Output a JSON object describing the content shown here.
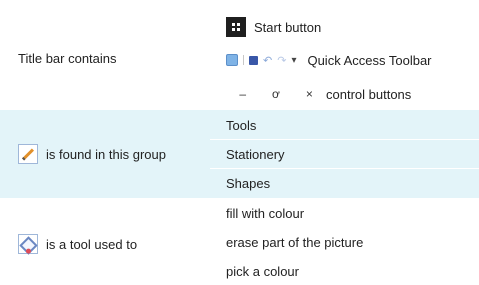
{
  "colors": {
    "band": "#e3f4f9",
    "white": "#ffffff"
  },
  "sections": [
    {
      "prompt": "Title bar contains",
      "answers": [
        "Start button",
        "Quick Access Toolbar",
        "control buttons"
      ],
      "controls": {
        "minimize": "–",
        "restore": "ơ",
        "close": "×"
      }
    },
    {
      "prompt": "is found in this group",
      "answers": [
        "Tools",
        "Stationery",
        "Shapes"
      ]
    },
    {
      "prompt": "is a tool used to",
      "answers": [
        "fill with colour",
        "erase part of the picture",
        "pick a colour"
      ]
    }
  ],
  "icons": {
    "start": "windows-start-icon",
    "qat": [
      "paint-app-icon",
      "separator-icon",
      "save-icon",
      "undo-icon",
      "redo-icon",
      "customize-dropdown-icon"
    ],
    "group": "pencil-icon",
    "tool": "fill-with-colour-icon"
  }
}
